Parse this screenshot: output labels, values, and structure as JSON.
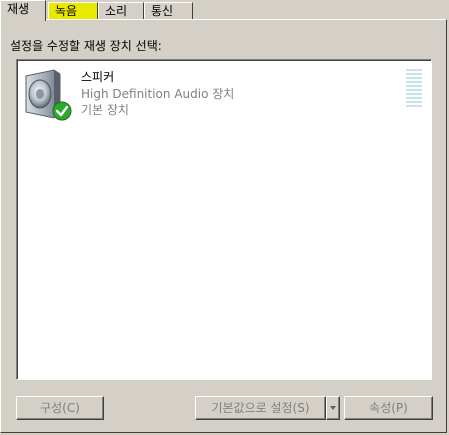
{
  "tabs": [
    {
      "label": "재생",
      "active": true
    },
    {
      "label": "녹음",
      "highlight": true
    },
    {
      "label": "소리"
    },
    {
      "label": "통신"
    }
  ],
  "instruction": "설정을 수정할 재생 장치 선택:",
  "devices": [
    {
      "name": "스피커",
      "description": "High Definition Audio 장치",
      "status": "기본 장치",
      "icon": "speaker-icon",
      "default_badge": "check-badge-icon",
      "level": 0
    }
  ],
  "buttons": {
    "configure": "구성(C)",
    "set_default": "기본값으로 설정(S)",
    "properties": "속성(P)"
  },
  "colors": {
    "dialog_bg": "#d4d0c8",
    "highlight_tab": "#e8e800",
    "meter": "#c4e4ec",
    "disabled_text": "#808080"
  }
}
